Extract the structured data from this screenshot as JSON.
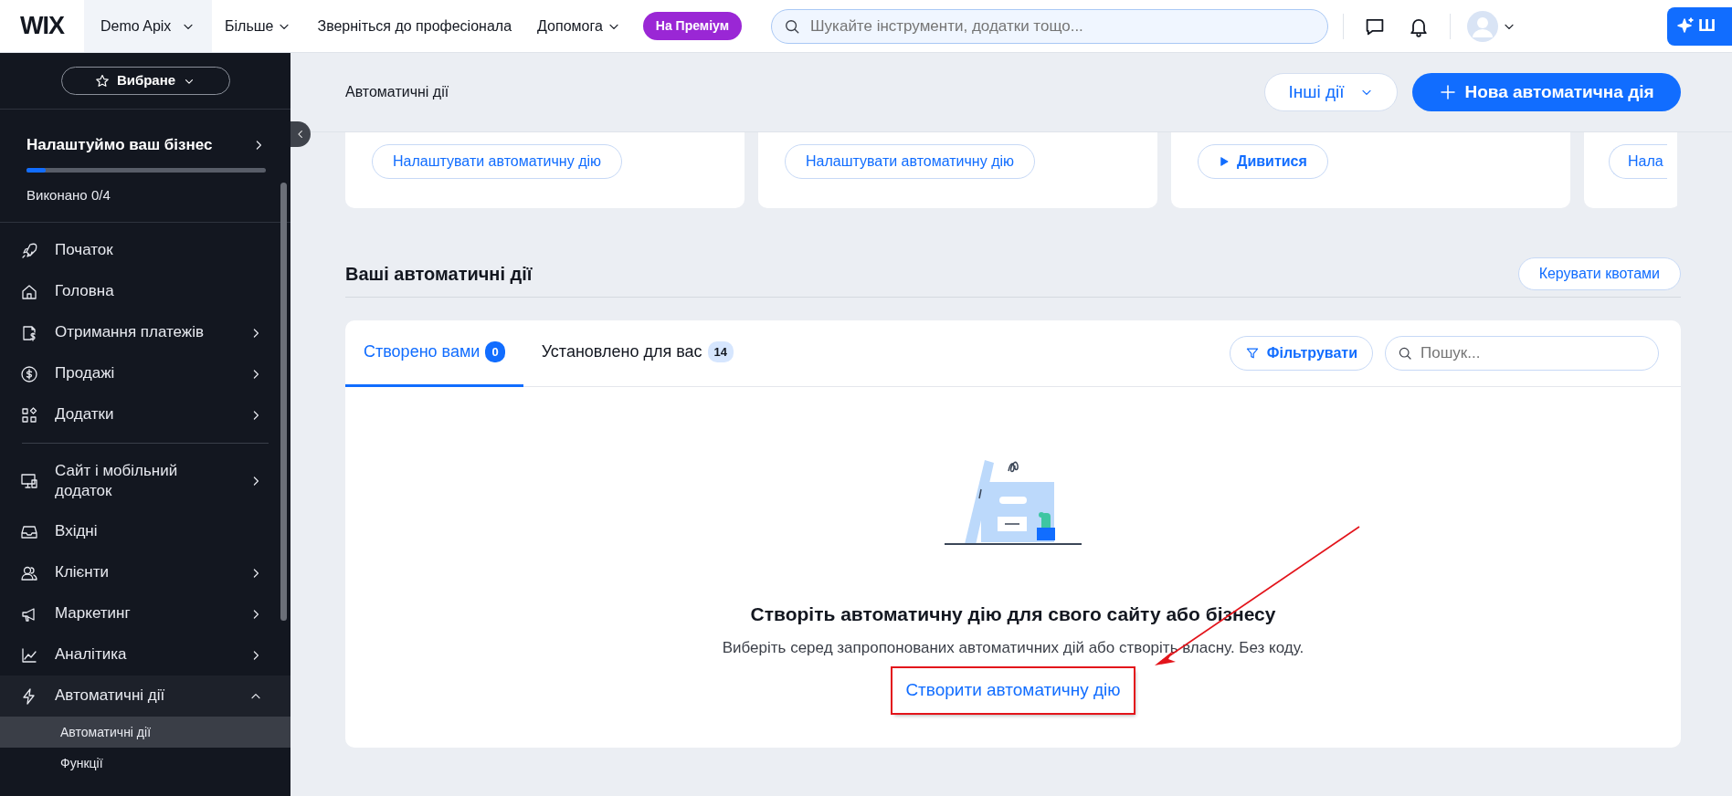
{
  "top_bar": {
    "logo": "WIX",
    "site_name": "Demo Apix",
    "menu": [
      {
        "label": "Більше",
        "dropdown": true
      },
      {
        "label": "Зверніться до професіонала",
        "dropdown": false
      },
      {
        "label": "Допомога",
        "dropdown": true
      }
    ],
    "upgrade_badge": "На Преміум",
    "search": {
      "placeholder": "Шукайте інструменти, додатки тощо..."
    },
    "ai_button": "Ш"
  },
  "sidebar": {
    "favorites": "Вибране",
    "setup": {
      "title": "Налаштуймо ваш бізнес",
      "level": 0.08,
      "progress": "Виконано 0/4"
    },
    "groups": [
      [
        {
          "label": "Початок",
          "submenu": false
        },
        {
          "label": "Головна",
          "submenu": false
        },
        {
          "label": "Отримання платежів",
          "submenu": true,
          "expanded": false
        },
        {
          "label": "Продажі",
          "submenu": true,
          "expanded": false
        },
        {
          "label": "Додатки",
          "submenu": true,
          "expanded": false
        }
      ],
      [
        {
          "label": "Сайт і мобільний додаток",
          "submenu": true,
          "expanded": false
        },
        {
          "label": "Вхідні",
          "submenu": false
        },
        {
          "label": "Клієнти",
          "submenu": true,
          "expanded": false
        },
        {
          "label": "Маркетинг",
          "submenu": true,
          "expanded": false
        },
        {
          "label": "Аналітика",
          "submenu": true,
          "expanded": false
        },
        {
          "label": "Автоматичні дії",
          "submenu": true,
          "expanded": true,
          "children": [
            {
              "label": "Автоматичні дії",
              "selected": true
            },
            {
              "label": "Функції",
              "selected": false
            }
          ]
        }
      ]
    ]
  },
  "header": {
    "title": "Автоматичні дії",
    "more_actions": "Інші дії",
    "new_button": "Нова автоматична дія"
  },
  "cards": [
    {
      "kind": "setup",
      "button": "Налаштувати автоматичну дію"
    },
    {
      "kind": "setup",
      "button": "Налаштувати автоматичну дію"
    },
    {
      "kind": "watch",
      "button": "Дивитися"
    },
    {
      "kind": "setup",
      "button": "Нала"
    }
  ],
  "section": {
    "title": "Ваші автоматичні дії",
    "manage_button": "Керувати квотами"
  },
  "tabs": [
    {
      "label": "Створено вами",
      "count": "0",
      "selected": true
    },
    {
      "label": "Установлено для вас",
      "count": "14",
      "selected": false
    }
  ],
  "filter_button": "Фільтрувати",
  "search": {
    "placeholder": "Пошук..."
  },
  "empty_state": {
    "title": "Створіть автоматичну дію для свого сайту або бізнесу",
    "text": "Виберіть серед запропонованих автоматичних дій або створіть власну. Без коду.",
    "link": "Створити автоматичну дію",
    "highlighted": true
  }
}
